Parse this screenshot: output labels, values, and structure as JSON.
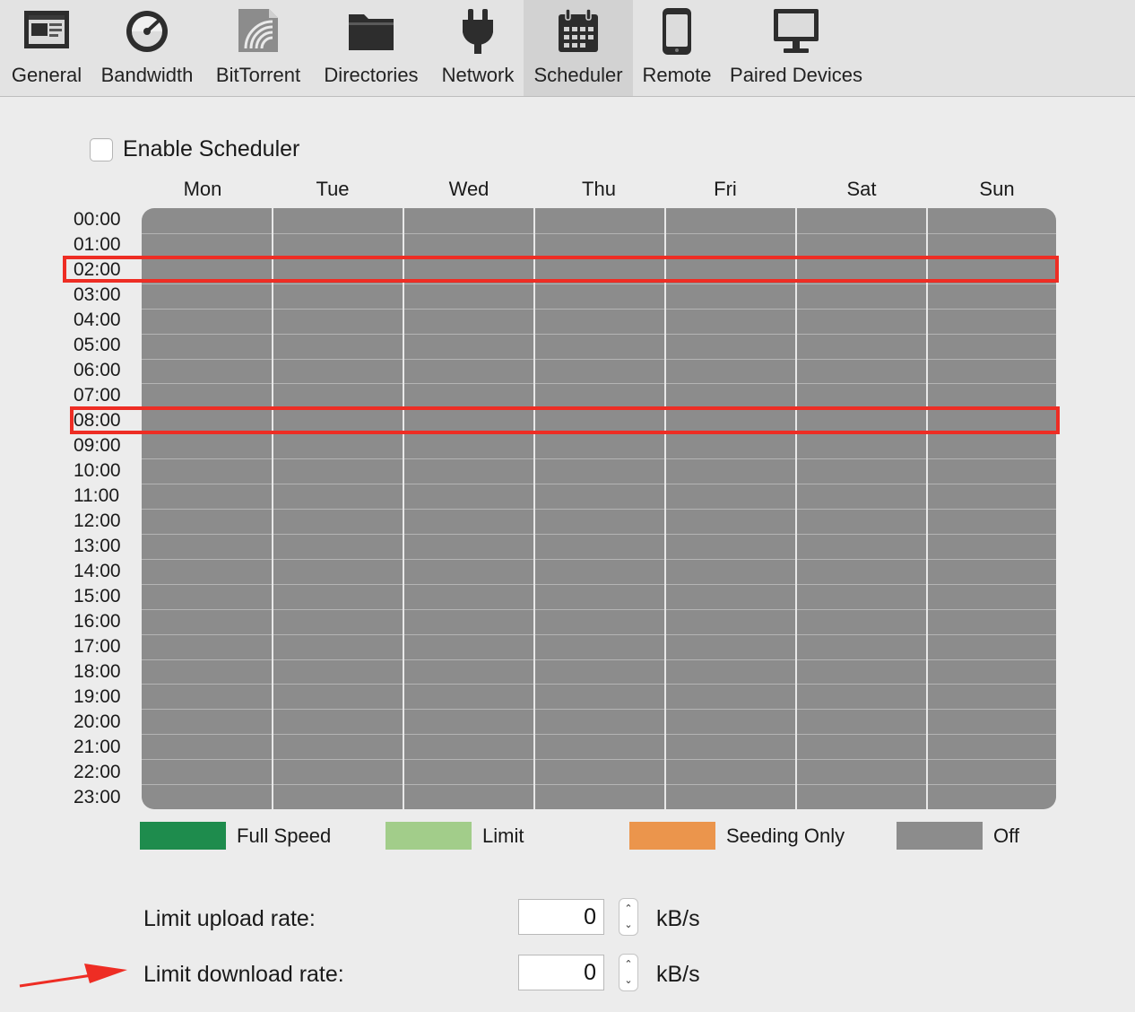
{
  "toolbar": {
    "tabs": [
      {
        "label": "General",
        "icon": "general-icon"
      },
      {
        "label": "Bandwidth",
        "icon": "gauge-icon"
      },
      {
        "label": "BitTorrent",
        "icon": "bittorrent-icon"
      },
      {
        "label": "Directories",
        "icon": "folder-icon"
      },
      {
        "label": "Network",
        "icon": "plug-icon"
      },
      {
        "label": "Scheduler",
        "icon": "calendar-icon"
      },
      {
        "label": "Remote",
        "icon": "phone-icon"
      },
      {
        "label": "Paired Devices",
        "icon": "monitor-icon"
      }
    ],
    "selected": "Scheduler"
  },
  "scheduler": {
    "enable_label": "Enable Scheduler",
    "enabled": false,
    "days": [
      "Mon",
      "Tue",
      "Wed",
      "Thu",
      "Fri",
      "Sat",
      "Sun"
    ],
    "hours": [
      "00:00",
      "01:00",
      "02:00",
      "03:00",
      "04:00",
      "05:00",
      "06:00",
      "07:00",
      "08:00",
      "09:00",
      "10:00",
      "11:00",
      "12:00",
      "13:00",
      "14:00",
      "15:00",
      "16:00",
      "17:00",
      "18:00",
      "19:00",
      "20:00",
      "21:00",
      "22:00",
      "23:00"
    ],
    "cell_state": "Off",
    "highlighted_hours": [
      "02:00",
      "08:00"
    ],
    "highlight_color": "#ee2d24"
  },
  "legend": {
    "items": [
      {
        "label": "Full Speed",
        "color": "#1e8c4d"
      },
      {
        "label": "Limit",
        "color": "#a2cd8a"
      },
      {
        "label": "Seeding Only",
        "color": "#eb954c"
      },
      {
        "label": "Off",
        "color": "#8c8c8c"
      }
    ]
  },
  "limits": {
    "upload": {
      "label": "Limit upload rate:",
      "value": "0",
      "unit": "kB/s"
    },
    "download": {
      "label": "Limit download rate:",
      "value": "0",
      "unit": "kB/s"
    }
  }
}
